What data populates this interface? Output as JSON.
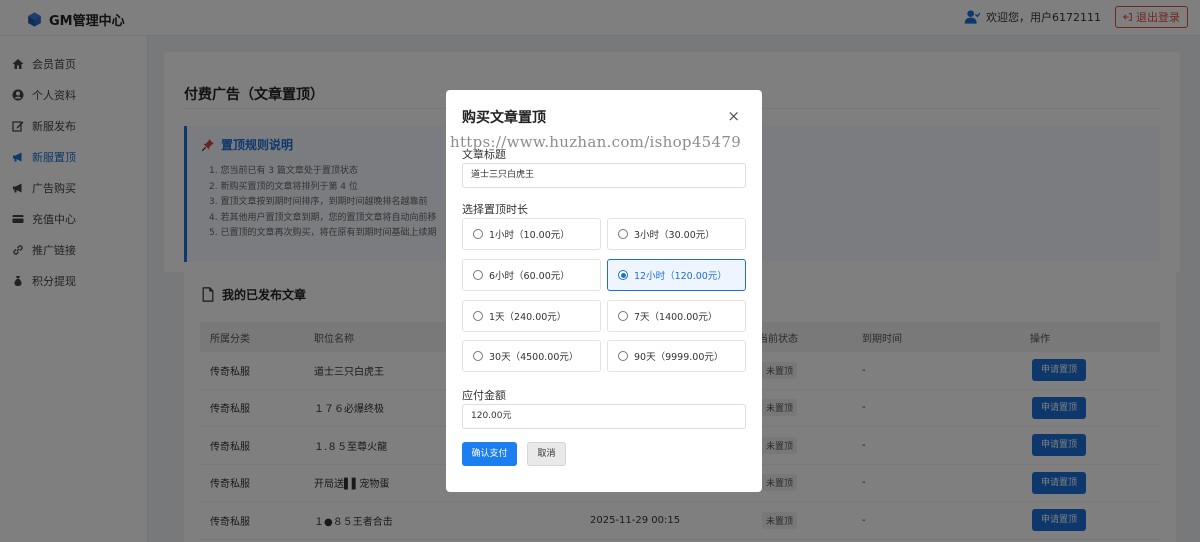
{
  "app": {
    "title": "GM管理中心",
    "logo_icon": "cube-icon"
  },
  "user": {
    "welcome": "欢迎您，用户6172111",
    "logout_label": "退出登录"
  },
  "colors": {
    "accent": "#1d6fd6",
    "danger": "#e74c3c"
  },
  "sidebar": {
    "items": [
      {
        "label": "会员首页",
        "icon": "home-icon",
        "active": false
      },
      {
        "label": "个人资料",
        "icon": "user-circle-icon",
        "active": false
      },
      {
        "label": "新服发布",
        "icon": "edit-icon",
        "active": false
      },
      {
        "label": "新服置顶",
        "icon": "megaphone-icon",
        "active": true
      },
      {
        "label": "广告购买",
        "icon": "megaphone-icon",
        "active": false
      },
      {
        "label": "充值中心",
        "icon": "credit-card-icon",
        "active": false
      },
      {
        "label": "推广链接",
        "icon": "link-icon",
        "active": false
      },
      {
        "label": "积分提现",
        "icon": "money-bag-icon",
        "active": false
      }
    ]
  },
  "page": {
    "title": "付费广告（文章置顶）",
    "rules_title": "置顶规则说明",
    "rules": [
      "1. 您当前已有 3 篇文章处于置顶状态",
      "2. 新购买置顶的文章将排列于第 4 位",
      "3. 置顶文章按到期时间排序，到期时间越晚排名越靠前",
      "4. 若其他用户置顶文章到期，您的置顶文章将自动向前移",
      "5. 已置顶的文章再次购买，将在原有到期时间基础上续期"
    ]
  },
  "articles": {
    "title": "我的已发布文章",
    "columns": [
      "所属分类",
      "职位名称",
      "当前状态",
      "到期时间",
      "操作"
    ],
    "rows": [
      {
        "category": "传奇私服",
        "name": "道士三只白虎王",
        "date": "",
        "status": "未置顶",
        "expire": "-",
        "action": "申请置顶"
      },
      {
        "category": "传奇私服",
        "name": "１７６必爆终极",
        "date": "",
        "status": "未置顶",
        "expire": "-",
        "action": "申请置顶"
      },
      {
        "category": "传奇私服",
        "name": "１.８５至尊火龍",
        "date": "",
        "status": "未置顶",
        "expire": "-",
        "action": "申请置顶"
      },
      {
        "category": "传奇私服",
        "name": "开局送▌▌宠物蛋",
        "date": "",
        "status": "未置顶",
        "expire": "-",
        "action": "申请置顶"
      },
      {
        "category": "传奇私服",
        "name": "１●８５王者合击",
        "date": "2025-11-29 00:15",
        "status": "未置顶",
        "expire": "-",
        "action": "申请置顶"
      }
    ]
  },
  "modal": {
    "title": "购买文章置顶",
    "watermark": "https://www.huzhan.com/ishop45479",
    "title_label": "文章标题",
    "title_value": "道士三只白虎王",
    "duration_label": "选择置顶时长",
    "options": [
      {
        "label": "1小时（10.00元）",
        "selected": false
      },
      {
        "label": "3小时（30.00元）",
        "selected": false
      },
      {
        "label": "6小时（60.00元）",
        "selected": false
      },
      {
        "label": "12小时（120.00元）",
        "selected": true
      },
      {
        "label": "1天（240.00元）",
        "selected": false
      },
      {
        "label": "7天（1400.00元）",
        "selected": false
      },
      {
        "label": "30天（4500.00元）",
        "selected": false
      },
      {
        "label": "90天（9999.00元）",
        "selected": false
      }
    ],
    "amount_label": "应付金额",
    "amount_value": "120.00元",
    "confirm_label": "确认支付",
    "cancel_label": "取消"
  }
}
